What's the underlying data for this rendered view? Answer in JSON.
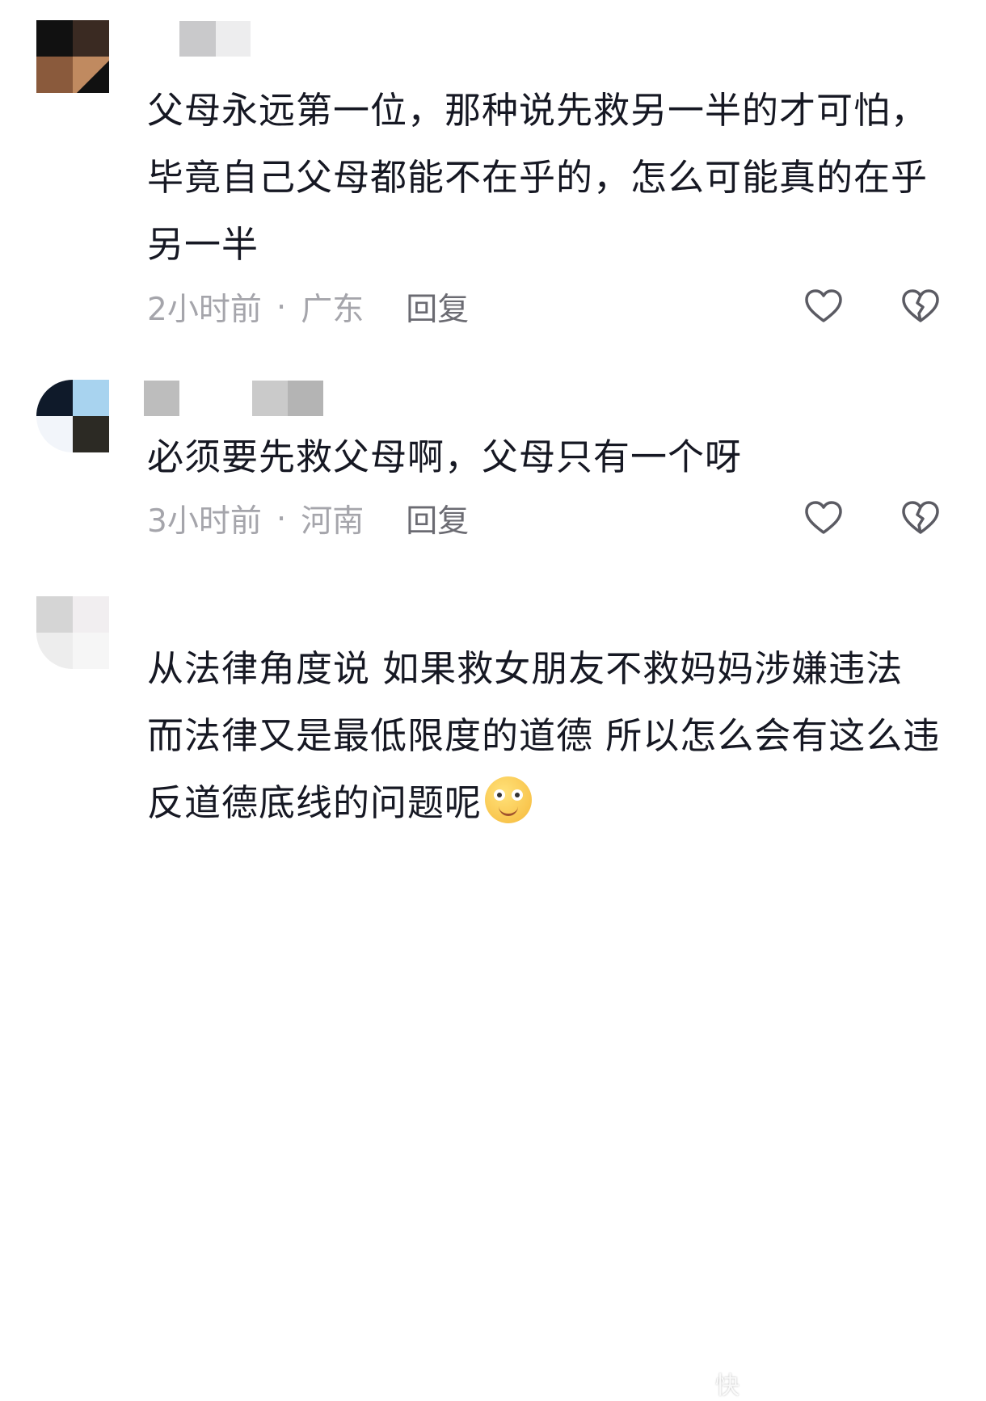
{
  "comments": [
    {
      "username": "",
      "text": "父母永远第一位，那种说先救另一半的才可怕，毕竟自己父母都能不在乎的，怎么可能真的在乎另一半",
      "time": "2小时前",
      "separator": "·",
      "location": "广东",
      "reply_label": "回复",
      "avatar_colors": [
        "#111111",
        "#3a2a22",
        "#8a5a3c",
        "#b07a55"
      ],
      "username_colors": [
        "#ffffff",
        "#c9c9cb",
        "#ededee"
      ]
    },
    {
      "username": "",
      "text": "必须要先救父母啊，父母只有一个呀",
      "time": "3小时前",
      "separator": "·",
      "location": "河南",
      "reply_label": "回复",
      "avatar_colors": [
        "#0f1a2a",
        "#a8d3ef",
        "#f2f5fa",
        "#2c2a24"
      ],
      "username_colors": [
        "#bdbdbd",
        "#ffffff",
        "#ffffff",
        "#cacaca",
        "#b4b4b4"
      ]
    },
    {
      "username": "",
      "text": "从法律角度说 如果救女朋友不救妈妈涉嫌违法 而法律又是最低限度的道德 所以怎么会有这么违反道德底线的问题呢",
      "emoji": "smile-emoji",
      "avatar_colors": [
        "#d5d5d5",
        "#f1eef0",
        "#ededed",
        "#f6f6f6"
      ]
    }
  ],
  "icons": {
    "like": "heart-outline-icon",
    "dislike": "broken-heart-icon"
  },
  "colors": {
    "text": "#161823",
    "meta": "#a5a5ab",
    "reply": "#6b6b72",
    "icon": "#5b5b63"
  },
  "watermark": "快"
}
